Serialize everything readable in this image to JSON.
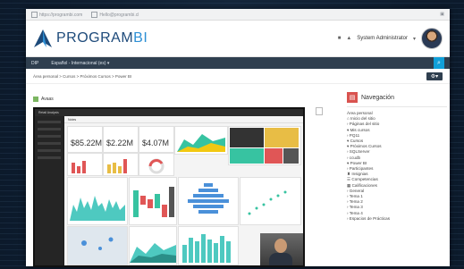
{
  "browser": {
    "top_links": [
      "https://programbi.com",
      "Hello@programbi.cl"
    ],
    "top_right_icon": "settings-icon"
  },
  "header": {
    "brand_part1": "PROGRAM",
    "brand_part2": "BI",
    "user_name": "System Administrator",
    "icons": [
      "comment-icon",
      "notification-icon"
    ]
  },
  "navbar": {
    "items": [
      "DIP",
      "Español - Internacional (es) ▾"
    ],
    "search_icon": "search-icon"
  },
  "breadcrumb": {
    "text": "Área personal > Cursos > Próximos Cursos > Power BI"
  },
  "activity": {
    "label": "Avaas"
  },
  "powerbi": {
    "title": "Retail Analysis",
    "tab": "Notes"
  },
  "kpis": [
    "$85.22M",
    "$2.22M",
    "$4.07M"
  ],
  "navigation": {
    "title": "Navegación",
    "items": [
      "Área personal",
      "⌂ Inicio del sitio",
      "› Páginas del sitio",
      "▾ Mis cursos",
      "   › PQ11",
      "▾ Cursos",
      "   ▾ Próximos Cursos",
      "      › SQLServer",
      "      › ccudb",
      "      ▾ Power BI",
      "         › Participantes",
      "         ♜ Insignias",
      "         ☰ Competencias",
      "         ▦ Calificaciones",
      "         › General",
      "         › Tema 1",
      "         › Tema 2",
      "         › Tema 3",
      "         › Tema 4",
      "   › Espacios de Prácticas"
    ]
  }
}
